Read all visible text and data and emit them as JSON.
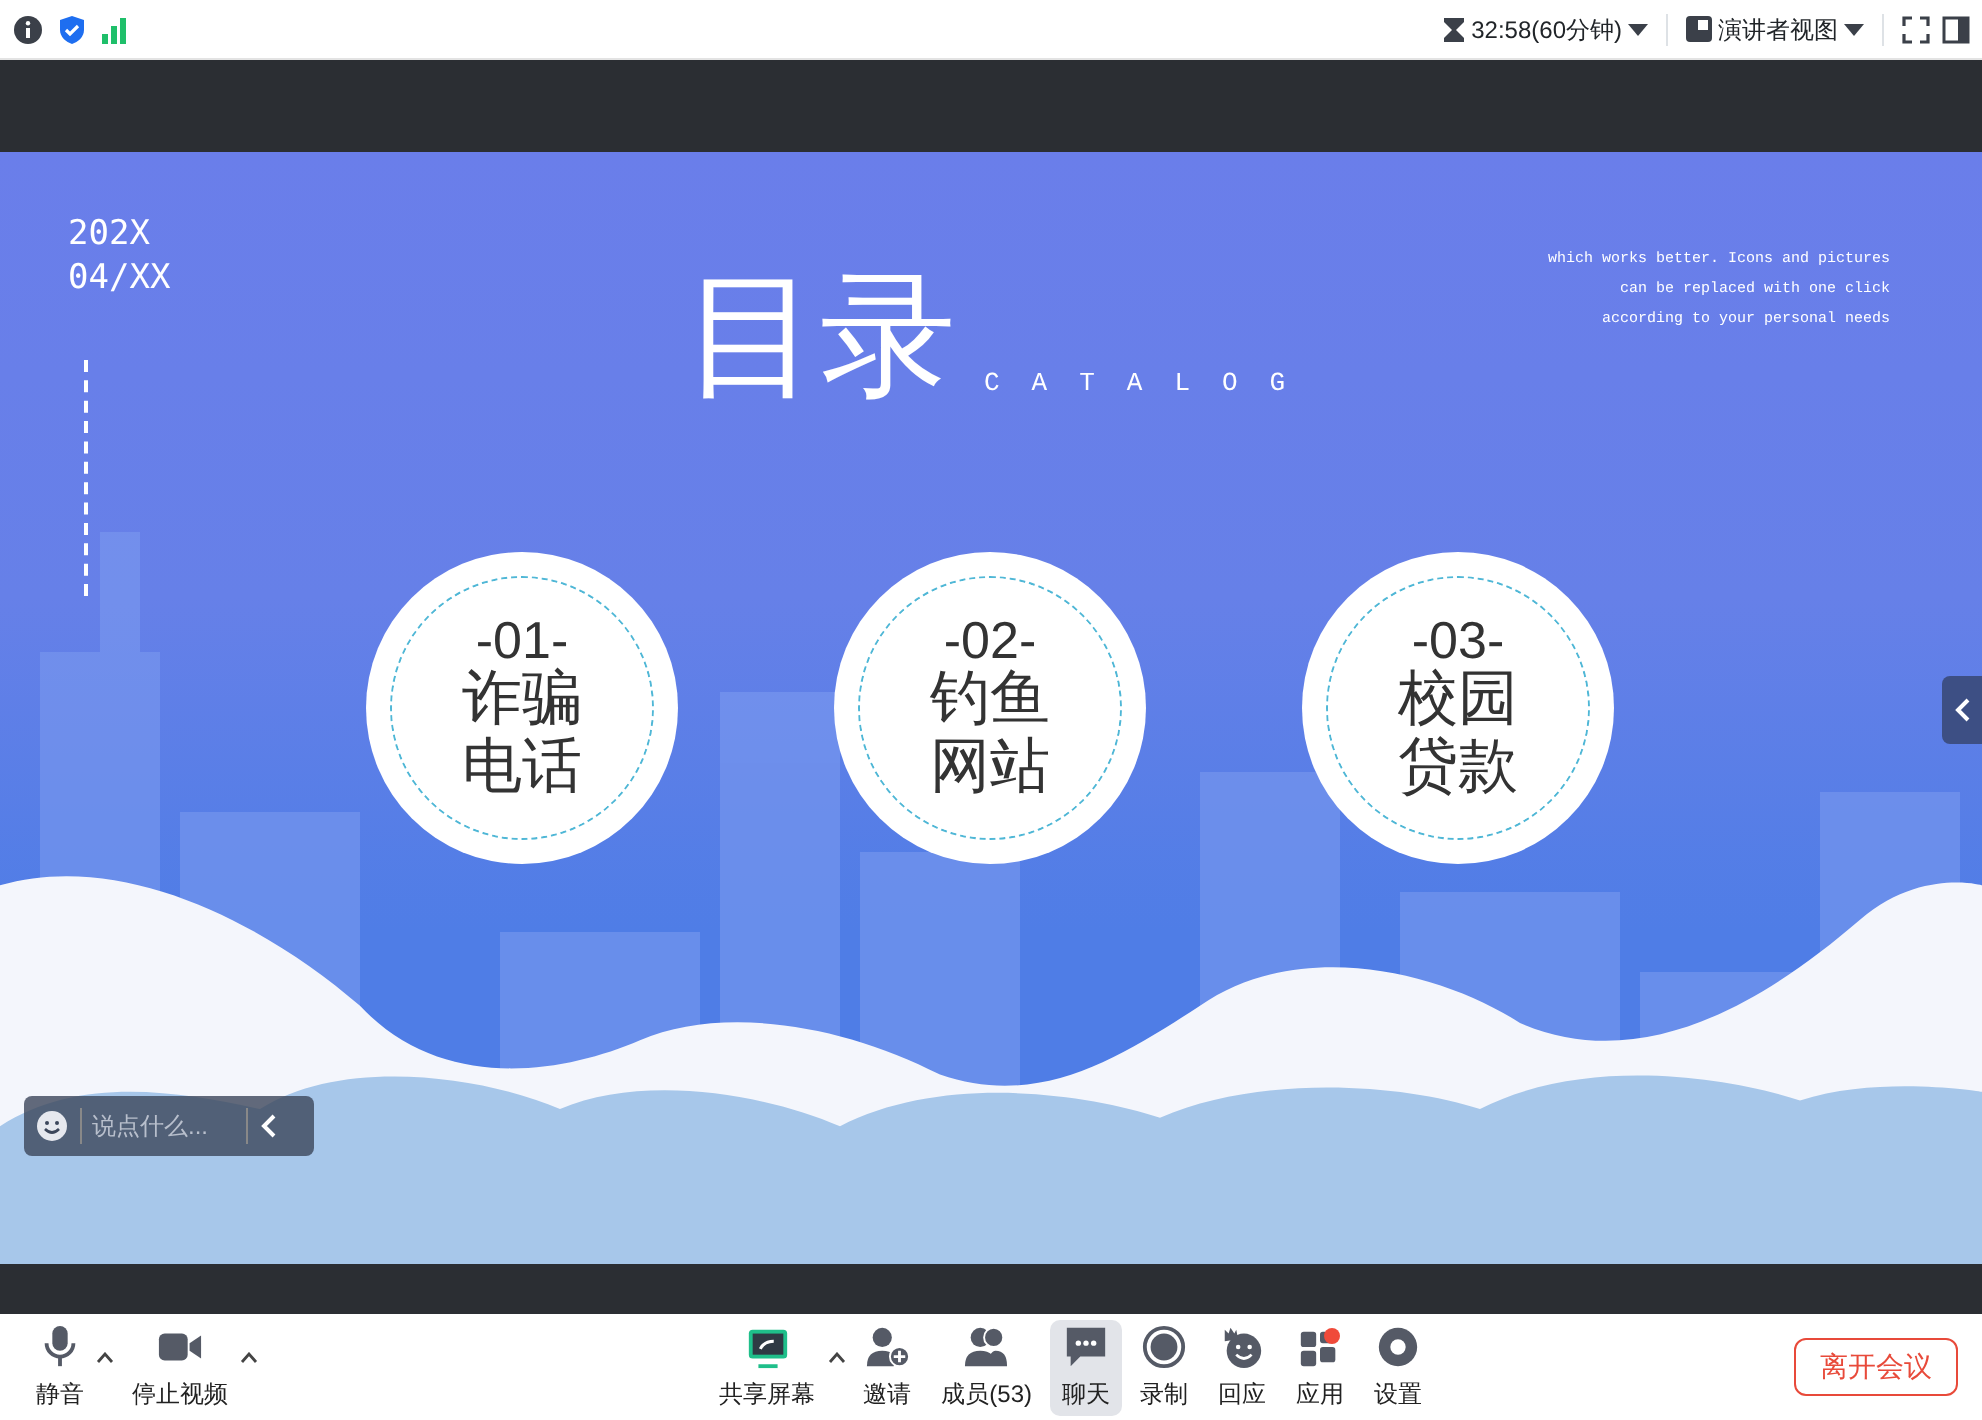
{
  "top_bar": {
    "timer": "32:58(60分钟)",
    "view_mode": "演讲者视图"
  },
  "slide": {
    "date_lines": [
      "202X",
      "04/XX"
    ],
    "title": "目录",
    "subtitle": "CATALOG",
    "note_lines": [
      "which works better. Icons and pictures",
      "can be replaced with one click",
      "according to your personal needs"
    ],
    "items": [
      {
        "number": "-01-",
        "title": "诈骗电话"
      },
      {
        "number": "-02-",
        "title": "钓鱼网站"
      },
      {
        "number": "-03-",
        "title": "校园贷款"
      }
    ]
  },
  "chat_input": {
    "placeholder": "说点什么..."
  },
  "toolbar": {
    "left": [
      {
        "kind": "mic",
        "label": "静音",
        "has_menu": true,
        "selected": false,
        "notification": false
      },
      {
        "kind": "video",
        "label": "停止视频",
        "has_menu": true,
        "selected": false,
        "notification": false
      }
    ],
    "center": [
      {
        "kind": "share",
        "label": "共享屏幕",
        "has_menu": true,
        "selected": false,
        "notification": false
      },
      {
        "kind": "invite",
        "label": "邀请",
        "has_menu": false,
        "selected": false,
        "notification": false
      },
      {
        "kind": "members",
        "label": "成员(53)",
        "has_menu": false,
        "selected": false,
        "notification": false
      },
      {
        "kind": "chat",
        "label": "聊天",
        "has_menu": false,
        "selected": true,
        "notification": false
      },
      {
        "kind": "record",
        "label": "录制",
        "has_menu": false,
        "selected": false,
        "notification": false
      },
      {
        "kind": "react",
        "label": "回应",
        "has_menu": false,
        "selected": false,
        "notification": false
      },
      {
        "kind": "apps",
        "label": "应用",
        "has_menu": false,
        "selected": false,
        "notification": true
      },
      {
        "kind": "settings",
        "label": "设置",
        "has_menu": false,
        "selected": false,
        "notification": false
      }
    ],
    "leave_button": "离开会议"
  }
}
